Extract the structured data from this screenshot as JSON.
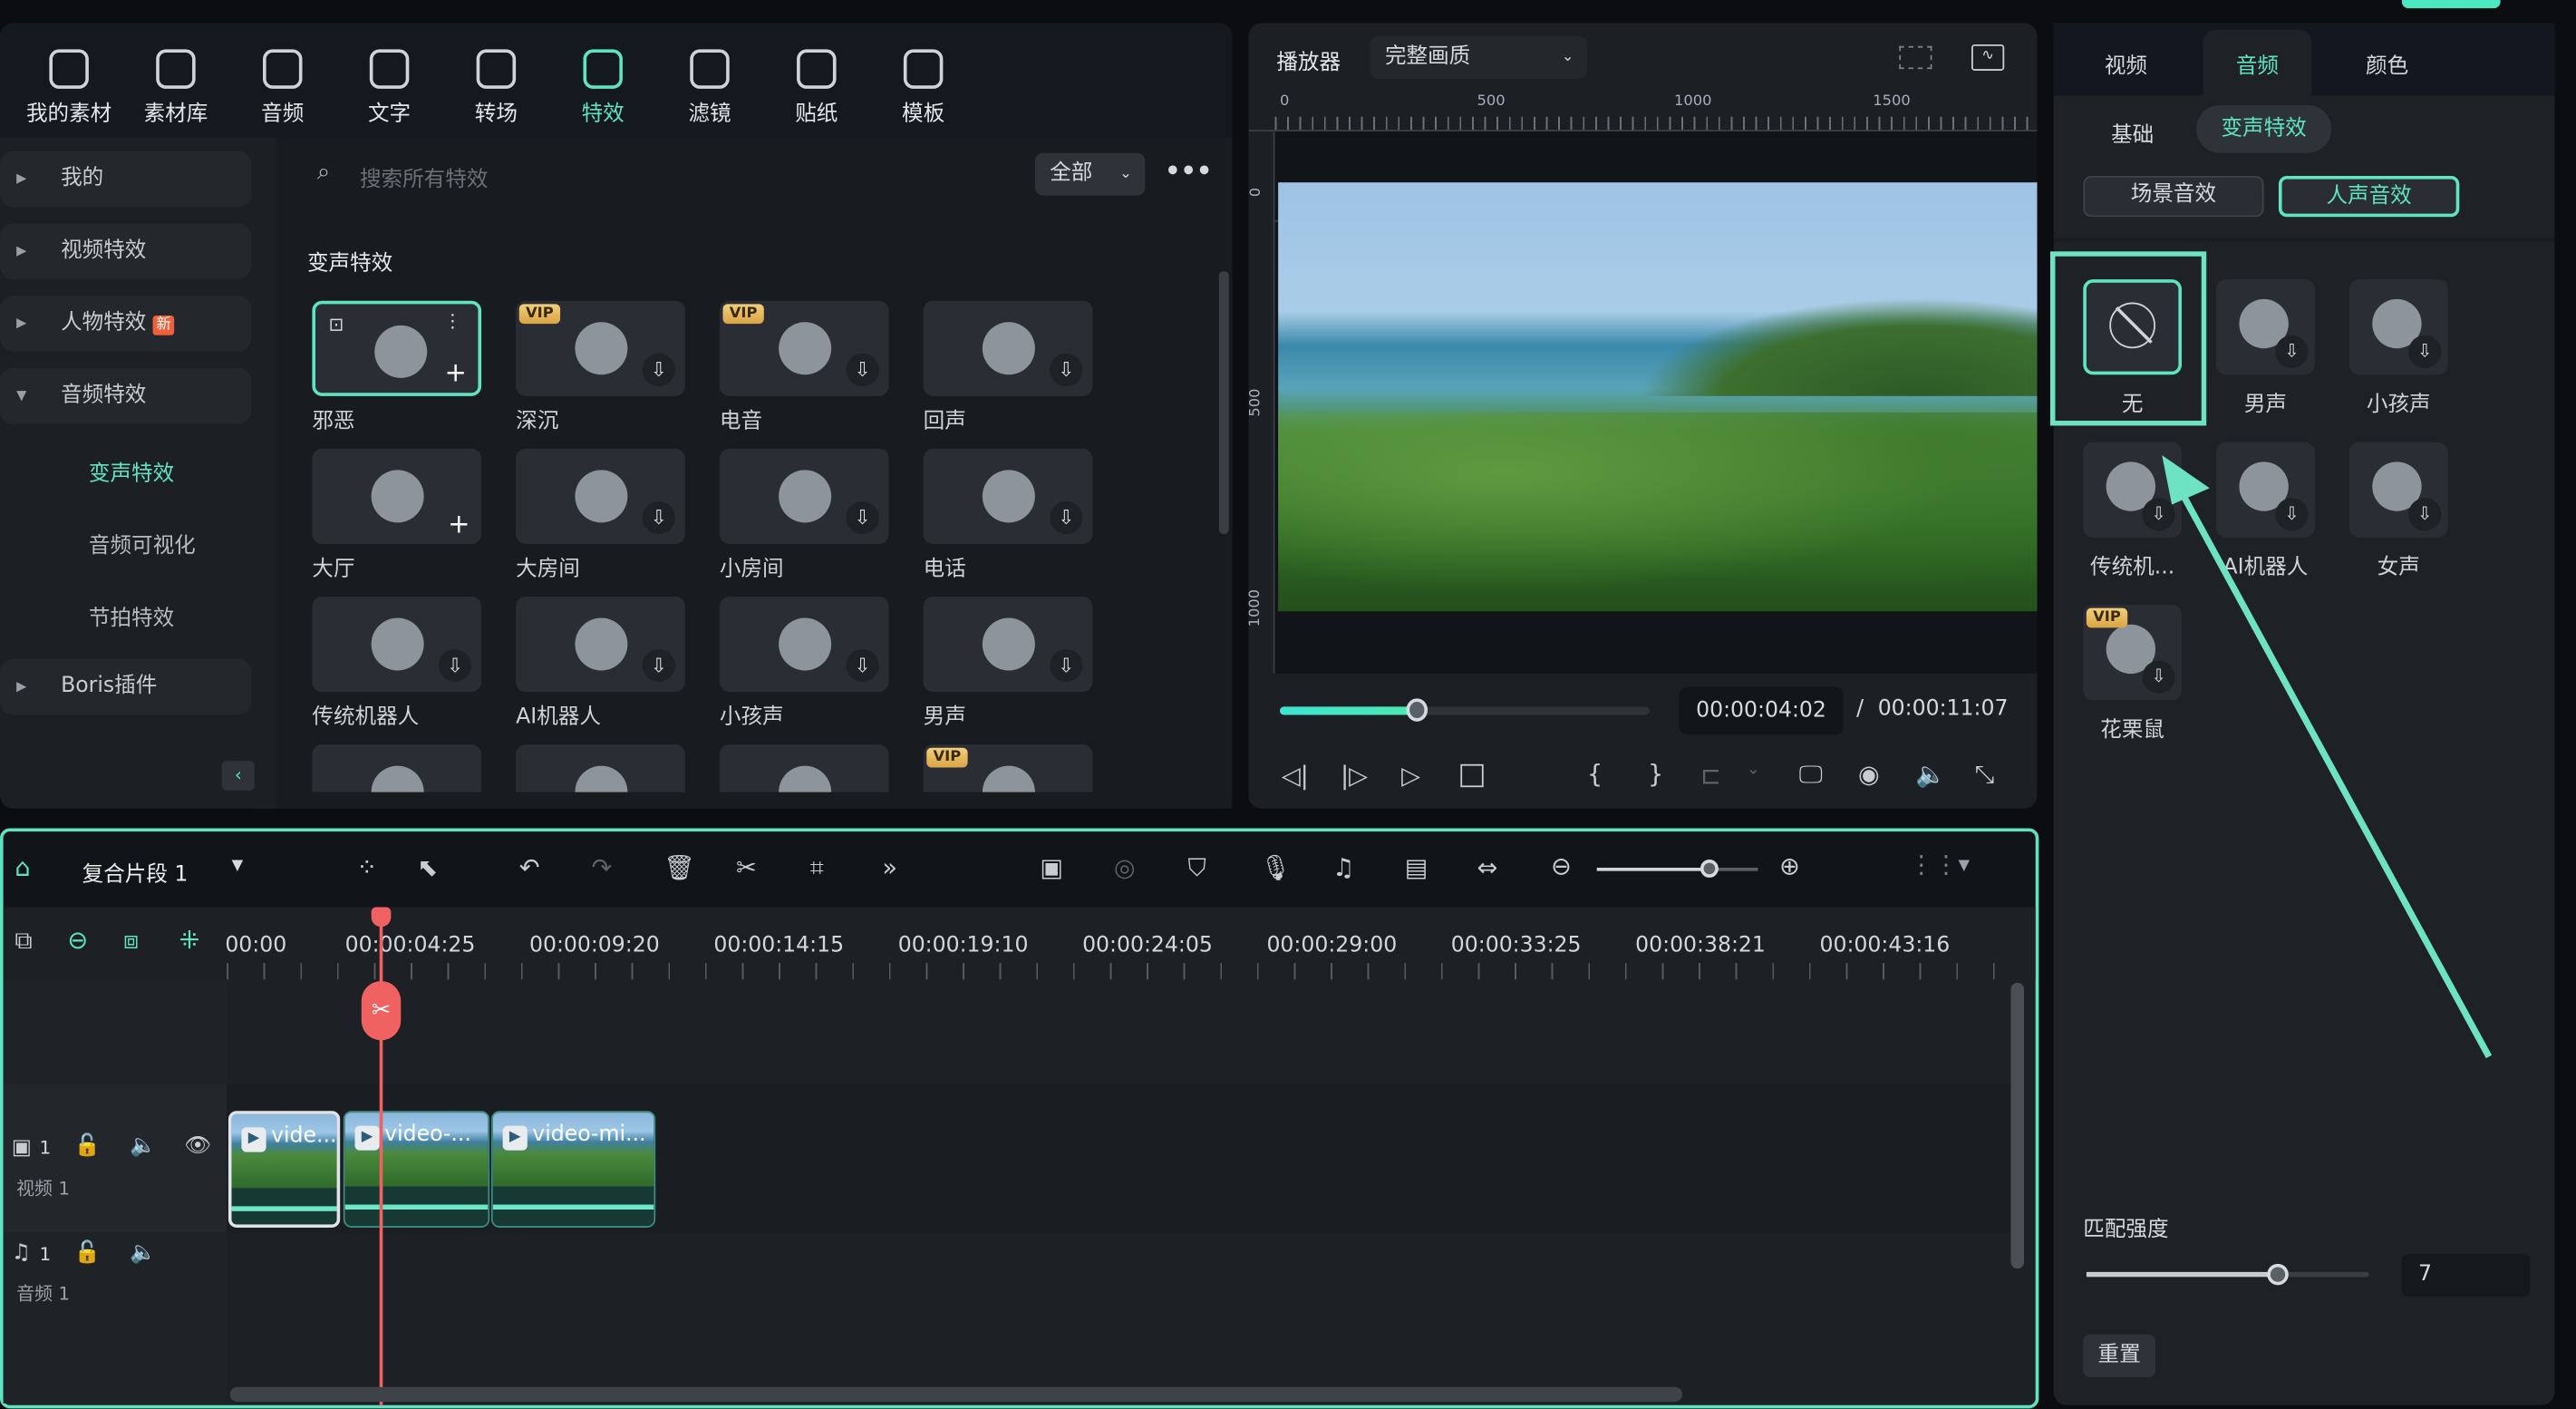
{
  "toolbar": {
    "items": [
      {
        "label": "我的素材",
        "icon": "my-media-icon"
      },
      {
        "label": "素材库",
        "icon": "stock-library-icon"
      },
      {
        "label": "音频",
        "icon": "music-note-icon"
      },
      {
        "label": "文字",
        "icon": "text-icon"
      },
      {
        "label": "转场",
        "icon": "transition-icon"
      },
      {
        "label": "特效",
        "icon": "effects-icon",
        "active": true
      },
      {
        "label": "滤镜",
        "icon": "filter-icon"
      },
      {
        "label": "贴纸",
        "icon": "sticker-icon"
      },
      {
        "label": "模板",
        "icon": "template-icon"
      }
    ]
  },
  "sidebar": {
    "categories": [
      {
        "label": "我的"
      },
      {
        "label": "视频特效"
      },
      {
        "label": "人物特效",
        "badge": "新"
      },
      {
        "label": "音频特效",
        "expanded": true
      }
    ],
    "subitems": [
      {
        "label": "变声特效",
        "active": true
      },
      {
        "label": "音频可视化"
      },
      {
        "label": "节拍特效"
      }
    ],
    "boris": "Boris插件"
  },
  "search": {
    "placeholder": "搜索所有特效",
    "filter": "全部"
  },
  "effects": {
    "section_title": "变声特效",
    "items": [
      {
        "label": "邪恶",
        "selected": true
      },
      {
        "label": "深沉",
        "vip": "VIP"
      },
      {
        "label": "电音",
        "vip": "VIP"
      },
      {
        "label": "回声"
      },
      {
        "label": "大厅"
      },
      {
        "label": "大房间"
      },
      {
        "label": "小房间"
      },
      {
        "label": "电话"
      },
      {
        "label": "传统机器人"
      },
      {
        "label": "AI机器人"
      },
      {
        "label": "小孩声"
      },
      {
        "label": "男声"
      },
      {
        "label": ""
      },
      {
        "label": ""
      },
      {
        "label": ""
      },
      {
        "label": "",
        "vip": "VIP"
      }
    ]
  },
  "player": {
    "title": "播放器",
    "quality": "完整画质",
    "ruler_h": [
      "0",
      "500",
      "1000",
      "1500"
    ],
    "ruler_v": [
      "0",
      "500",
      "1000"
    ],
    "progress": 0.37,
    "current_time": "00:00:04:02",
    "separator": "/",
    "total_time": "00:00:11:07"
  },
  "inspector": {
    "tabs": [
      "视频",
      "音频",
      "颜色"
    ],
    "active_tab": "音频",
    "subtabs": [
      "基础",
      "变声特效"
    ],
    "active_subtab": "变声特效",
    "groups": [
      "场景音效",
      "人声音效"
    ],
    "active_group": "人声音效",
    "voices": [
      {
        "label": "无",
        "selected": true
      },
      {
        "label": "男声"
      },
      {
        "label": "小孩声"
      },
      {
        "label": "传统机..."
      },
      {
        "label": "AI机器人"
      },
      {
        "label": "女声"
      },
      {
        "label": "花栗鼠",
        "vip": "VIP"
      }
    ],
    "strength_label": "匹配强度",
    "strength_value": "7",
    "strength_fraction": 0.68,
    "reset": "重置"
  },
  "timeline": {
    "sequence": "复合片段 1",
    "times": [
      "00:00",
      "00:00:04:25",
      "00:00:09:20",
      "00:00:14:15",
      "00:00:19:10",
      "00:00:24:05",
      "00:00:29:00",
      "00:00:33:25",
      "00:00:38:21",
      "00:00:43:16"
    ],
    "zoom_fraction": 0.7,
    "video_track": {
      "index": "1",
      "label": "视频 1"
    },
    "audio_track": {
      "index": "1",
      "label": "音频 1"
    },
    "clips": [
      "vide...",
      "video-...",
      "video-mi..."
    ]
  },
  "colors": {
    "accent": "#5fe3c0",
    "playhead": "#f06262",
    "annotation": "#6ee3c4"
  }
}
